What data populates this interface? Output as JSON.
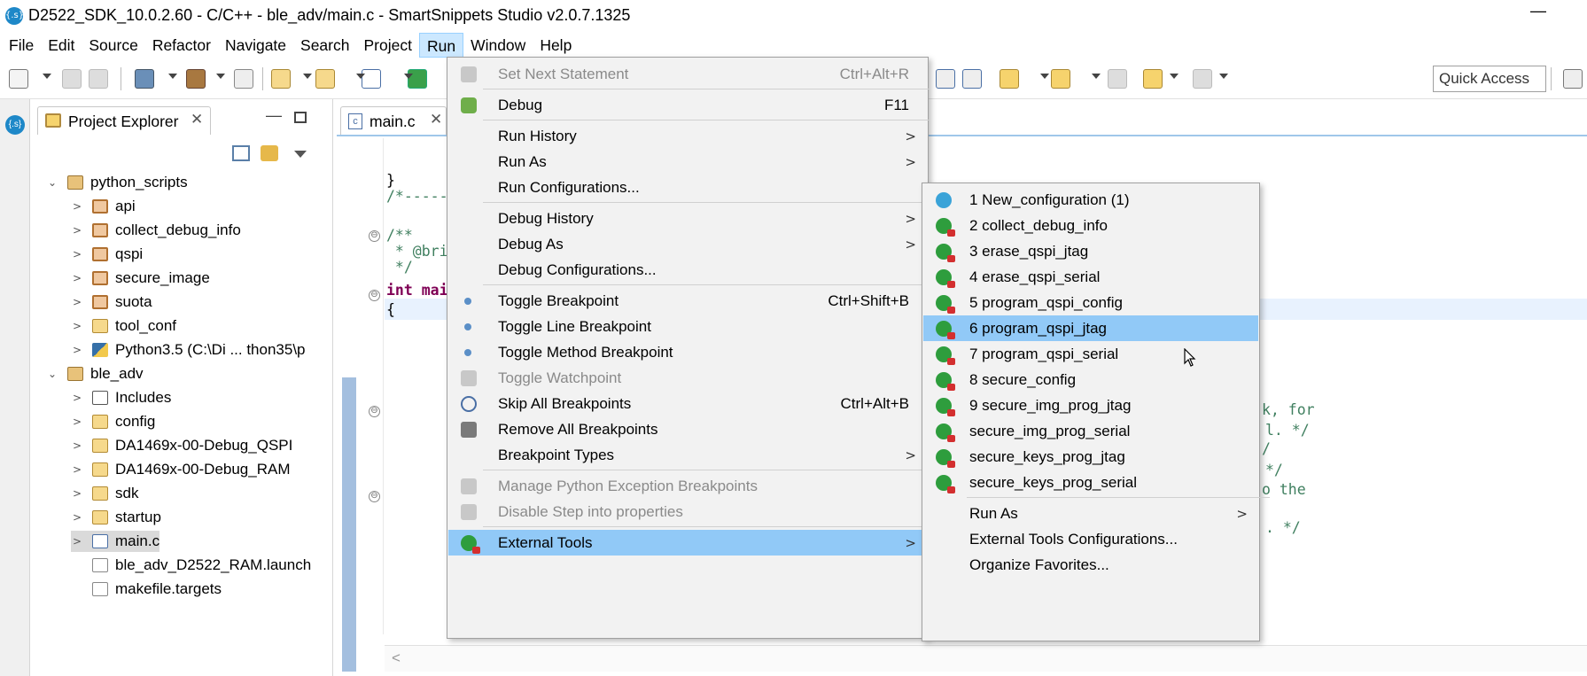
{
  "window": {
    "title": "D2522_SDK_10.0.2.60 - C/C++ - ble_adv/main.c - SmartSnippets Studio v2.0.7.1325",
    "app_icon_text": "{.s}",
    "minimize_glyph": "—"
  },
  "menubar": [
    "File",
    "Edit",
    "Source",
    "Refactor",
    "Navigate",
    "Search",
    "Project",
    "Run",
    "Window",
    "Help"
  ],
  "toolbar": {
    "quick_access": "Quick Access"
  },
  "explorer": {
    "tab_label": "Project Explorer",
    "close_glyph": "✕",
    "min_glyph": "—",
    "tree": [
      {
        "label": "python_scripts",
        "twisty": "⌄",
        "icon": "proj",
        "indent": 0
      },
      {
        "label": "api",
        "twisty": ">",
        "icon": "pkg",
        "indent": 1
      },
      {
        "label": "collect_debug_info",
        "twisty": ">",
        "icon": "pkg",
        "indent": 1
      },
      {
        "label": "qspi",
        "twisty": ">",
        "icon": "pkg",
        "indent": 1
      },
      {
        "label": "secure_image",
        "twisty": ">",
        "icon": "pkg",
        "indent": 1
      },
      {
        "label": "suota",
        "twisty": ">",
        "icon": "pkg",
        "indent": 1
      },
      {
        "label": "tool_conf",
        "twisty": ">",
        "icon": "folder",
        "indent": 1
      },
      {
        "label": "Python3.5  (C:\\Di ... thon35\\p",
        "twisty": ">",
        "icon": "python",
        "indent": 1
      },
      {
        "label": "ble_adv",
        "twisty": "⌄",
        "icon": "proj",
        "indent": 0
      },
      {
        "label": "Includes",
        "twisty": ">",
        "icon": "includes",
        "indent": 1
      },
      {
        "label": "config",
        "twisty": ">",
        "icon": "folder",
        "indent": 1
      },
      {
        "label": "DA1469x-00-Debug_QSPI",
        "twisty": ">",
        "icon": "folder",
        "indent": 1
      },
      {
        "label": "DA1469x-00-Debug_RAM",
        "twisty": ">",
        "icon": "folder",
        "indent": 1
      },
      {
        "label": "sdk",
        "twisty": ">",
        "icon": "folder",
        "indent": 1
      },
      {
        "label": "startup",
        "twisty": ">",
        "icon": "folder",
        "indent": 1
      },
      {
        "label": "main.c",
        "twisty": ">",
        "icon": "cfile",
        "indent": 1,
        "selected": true
      },
      {
        "label": "ble_adv_D2522_RAM.launch",
        "twisty": "",
        "icon": "file",
        "indent": 1
      },
      {
        "label": "makefile.targets",
        "twisty": "",
        "icon": "file",
        "indent": 1
      }
    ]
  },
  "editor": {
    "tab_label": "main.c",
    "tab_icon_text": "c",
    "close_glyph": "✕",
    "fold_glyph": "⊖",
    "scroll_left_glyph": "<",
    "code_lines": [
      {
        "text": "}",
        "cls": "plain"
      },
      {
        "text": "/*------",
        "cls": "comment"
      },
      {
        "text": "/**",
        "cls": "comment"
      },
      {
        "text": " * @bri",
        "cls": "comment"
      },
      {
        "text": " */",
        "cls": "comment"
      },
      {
        "text": "int mai",
        "cls": "kw"
      },
      {
        "text": "{",
        "cls": "plain"
      }
    ],
    "right_code_lines": [
      "k, for",
      "l. */",
      "/",
      "*/",
      "o the",
      ". */"
    ]
  },
  "run_menu": {
    "items": [
      {
        "label": "Set Next Statement",
        "accel": "Ctrl+Alt+R",
        "icon": "arrow",
        "disabled": true
      },
      {
        "sep": true
      },
      {
        "label": "Debug",
        "accel": "F11",
        "icon": "cog"
      },
      {
        "sep": true
      },
      {
        "label": "Run History",
        "arrow": ">"
      },
      {
        "label": "Run As",
        "arrow": ">"
      },
      {
        "label": "Run Configurations..."
      },
      {
        "sep": true
      },
      {
        "label": "Debug History",
        "arrow": ">"
      },
      {
        "label": "Debug As",
        "arrow": ">"
      },
      {
        "label": "Debug Configurations..."
      },
      {
        "sep": true
      },
      {
        "label": "Toggle Breakpoint",
        "accel": "Ctrl+Shift+B",
        "icon": "dot"
      },
      {
        "label": "Toggle Line Breakpoint",
        "icon": "dot"
      },
      {
        "label": "Toggle Method Breakpoint",
        "icon": "dot"
      },
      {
        "label": "Toggle Watchpoint",
        "icon": "grey",
        "disabled": true
      },
      {
        "label": "Skip All Breakpoints",
        "accel": "Ctrl+Alt+B",
        "icon": "skip"
      },
      {
        "label": "Remove All Breakpoints",
        "icon": "remove"
      },
      {
        "label": "Breakpoint Types",
        "arrow": ">"
      },
      {
        "sep": true
      },
      {
        "label": "Manage Python Exception Breakpoints",
        "icon": "grey",
        "disabled": true
      },
      {
        "label": "Disable Step into properties",
        "icon": "grey",
        "disabled": true
      },
      {
        "sep": true
      },
      {
        "label": "External Tools",
        "arrow": ">",
        "icon": "ext",
        "highlight": true
      }
    ]
  },
  "external_tools_menu": {
    "items": [
      {
        "label": "1 New_configuration (1)",
        "icon": "cfg"
      },
      {
        "label": "2 collect_debug_info",
        "icon": "ext"
      },
      {
        "label": "3 erase_qspi_jtag",
        "icon": "ext"
      },
      {
        "label": "4 erase_qspi_serial",
        "icon": "ext"
      },
      {
        "label": "5 program_qspi_config",
        "icon": "ext"
      },
      {
        "label": "6 program_qspi_jtag",
        "icon": "ext",
        "highlight": true
      },
      {
        "label": "7 program_qspi_serial",
        "icon": "ext"
      },
      {
        "label": "8 secure_config",
        "icon": "ext"
      },
      {
        "label": "9 secure_img_prog_jtag",
        "icon": "ext"
      },
      {
        "label": "secure_img_prog_serial",
        "icon": "ext"
      },
      {
        "label": "secure_keys_prog_jtag",
        "icon": "ext"
      },
      {
        "label": "secure_keys_prog_serial",
        "icon": "ext"
      },
      {
        "sep": true
      },
      {
        "label": "Run As",
        "arrow": ">"
      },
      {
        "label": "External Tools Configurations..."
      },
      {
        "label": "Organize Favorites..."
      }
    ]
  }
}
